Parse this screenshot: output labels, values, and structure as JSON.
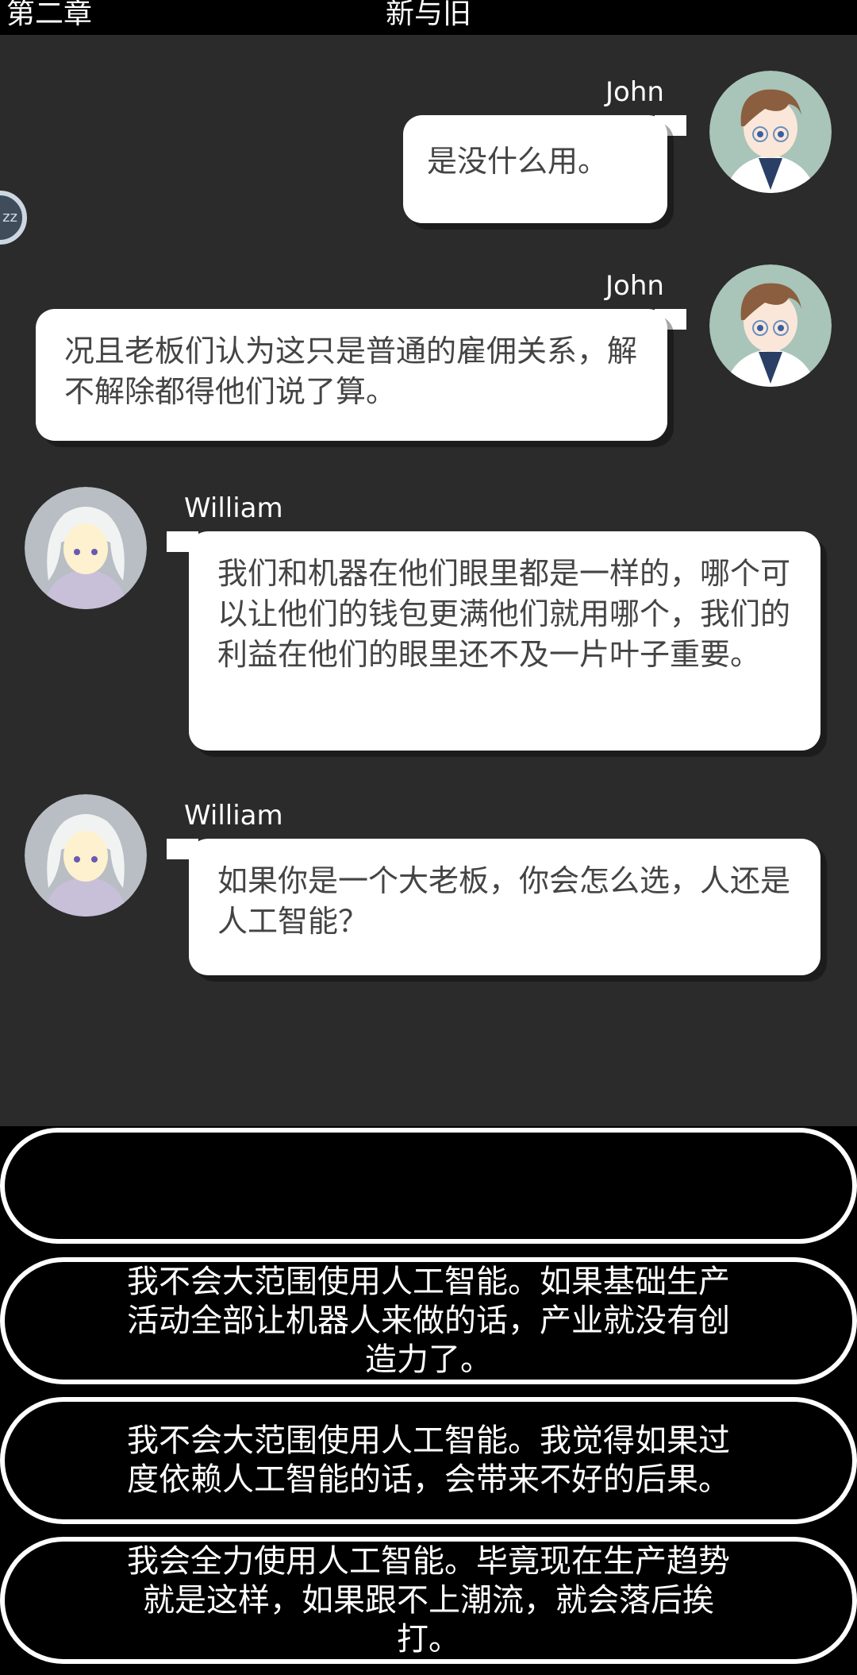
{
  "header": {
    "chapter": "第二章",
    "title": "新与旧"
  },
  "sleep_button": {
    "label": "zz"
  },
  "messages": [
    {
      "speaker": "John",
      "text": "是没什么用。"
    },
    {
      "speaker": "John",
      "text": "况且老板们认为这只是普通的雇佣关系，解不解除都得他们说了算。"
    },
    {
      "speaker": "William",
      "text": "我们和机器在他们眼里都是一样的，哪个可以让他们的钱包更满他们就用哪个，我们的利益在他们的眼里还不及一片叶子重要。"
    },
    {
      "speaker": "William",
      "text": "如果你是一个大老板，你会怎么选，人还是人工智能？"
    }
  ],
  "choices": [
    {
      "text": ""
    },
    {
      "text": "我不会大范围使用人工智能。如果基础生产活动全部让机器人来做的话，产业就没有创造力了。"
    },
    {
      "text": "我不会大范围使用人工智能。我觉得如果过度依赖人工智能的话，会带来不好的后果。"
    },
    {
      "text": "我会全力使用人工智能。毕竟现在生产趋势就是这样，如果跟不上潮流，就会落后挨打。"
    }
  ]
}
